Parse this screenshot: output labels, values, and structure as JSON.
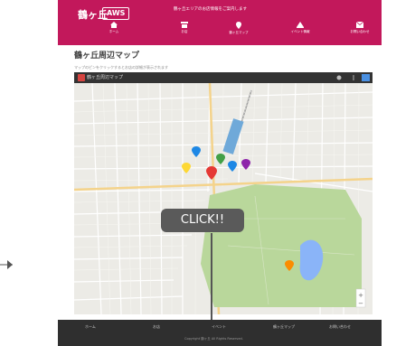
{
  "header": {
    "logo_text": "鶴ヶ丘",
    "logo_badge": "AWS",
    "tagline": "鶴ヶ丘エリアのお店情報をご案内します",
    "nav": [
      {
        "label": "ホーム",
        "icon": "home-icon"
      },
      {
        "label": "お店",
        "icon": "shop-icon"
      },
      {
        "label": "鶴ヶ丘マップ",
        "icon": "map-pin-icon"
      },
      {
        "label": "イベント情報",
        "icon": "event-icon"
      },
      {
        "label": "お問い合わせ",
        "icon": "mail-icon"
      }
    ]
  },
  "main": {
    "title": "鶴ヶ丘周辺マップ",
    "subtitle": "マップのピンをクリックするとお店の詳細が表示されます",
    "map_title": "鶴ヶ丘周辺マップ"
  },
  "callout": {
    "text": "CLICK!!"
  },
  "footer": {
    "items": [
      "ホーム",
      "お店",
      "イベント",
      "鶴ヶ丘マップ",
      "お問い合わせ"
    ],
    "copyright": "Copyright 鶴ヶ丘 All Rights Reserved."
  },
  "colors": {
    "accent": "#c2185b",
    "footer": "#2f2f2f",
    "map_land": "#ecebe6",
    "map_park": "#b9d79b",
    "map_water": "#8ab4f8"
  }
}
